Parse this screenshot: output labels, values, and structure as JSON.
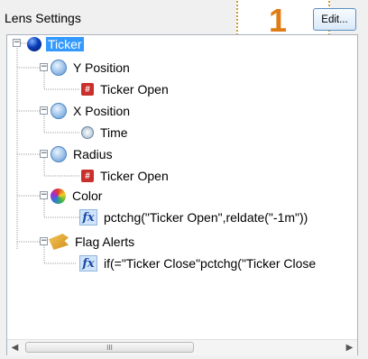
{
  "panel": {
    "title": "Lens Settings",
    "edit_label": "Edit...",
    "callout_number": "1"
  },
  "tree": {
    "nodes": [
      {
        "label": "Ticker",
        "icon": "globe-icon",
        "selected": true
      },
      {
        "label": "Y Position",
        "icon": "vertical-arrows-icon"
      },
      {
        "label": "Ticker Open",
        "icon": "data-field-icon"
      },
      {
        "label": "X Position",
        "icon": "horizontal-arrows-icon"
      },
      {
        "label": "Time",
        "icon": "clock-icon"
      },
      {
        "label": "Radius",
        "icon": "radius-icon"
      },
      {
        "label": "Ticker Open",
        "icon": "data-field-icon"
      },
      {
        "label": "Color",
        "icon": "color-wheel-icon"
      },
      {
        "label": "pctchg(\"Ticker Open\",reldate(\"-1m\"))",
        "icon": "formula-icon"
      },
      {
        "label": "Flag Alerts",
        "icon": "flag-icon"
      },
      {
        "label": "if(=\"Ticker Close\"pctchg(\"Ticker Close",
        "icon": "formula-icon"
      }
    ]
  },
  "scrollbar": {
    "thumb_grip": "III"
  },
  "colors": {
    "selection": "#3399ff",
    "callout": "#e07c14",
    "field_icon": "#c9302b"
  }
}
